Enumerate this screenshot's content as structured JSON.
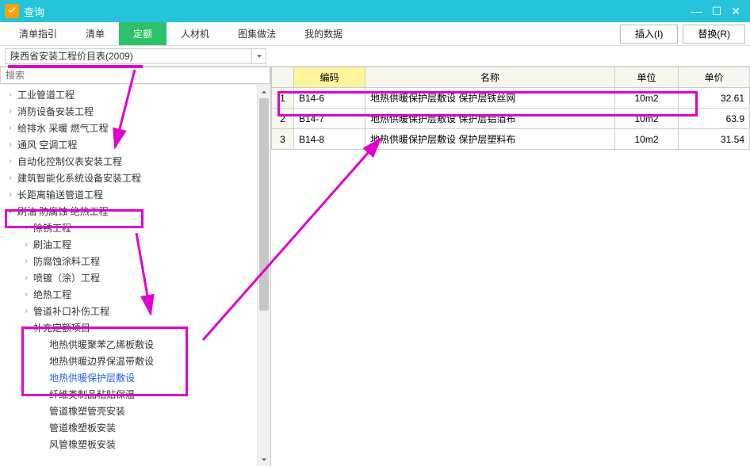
{
  "title": "查询",
  "main_tabs": [
    "清单指引",
    "清单",
    "定额",
    "人材机",
    "图集做法",
    "我的数据"
  ],
  "active_tab_index": 2,
  "top_buttons": {
    "insert": "插入(I)",
    "replace": "替换(R)"
  },
  "combo_text": "陕西省安装工程价目表(2009)",
  "search_placeholder": "搜索",
  "tree": [
    {
      "level": 1,
      "toggle": ">",
      "label": "工业管道工程"
    },
    {
      "level": 1,
      "toggle": ">",
      "label": "消防设备安装工程"
    },
    {
      "level": 1,
      "toggle": ">",
      "label": "给排水 采暖 燃气工程"
    },
    {
      "level": 1,
      "toggle": ">",
      "label": "通风 空调工程"
    },
    {
      "level": 1,
      "toggle": ">",
      "label": "自动化控制仪表安装工程"
    },
    {
      "level": 1,
      "toggle": ">",
      "label": "建筑智能化系统设备安装工程"
    },
    {
      "level": 1,
      "toggle": ">",
      "label": "长距离输送管道工程"
    },
    {
      "level": 1,
      "toggle": "v",
      "label": "刷油 防腐蚀 绝热工程"
    },
    {
      "level": 2,
      "toggle": ">",
      "label": "除锈工程"
    },
    {
      "level": 2,
      "toggle": ">",
      "label": "刷油工程"
    },
    {
      "level": 2,
      "toggle": ">",
      "label": "防腐蚀涂料工程"
    },
    {
      "level": 2,
      "toggle": ">",
      "label": "喷镀（涂）工程"
    },
    {
      "level": 2,
      "toggle": ">",
      "label": "绝热工程"
    },
    {
      "level": 2,
      "toggle": ">",
      "label": "管道补口补伤工程"
    },
    {
      "level": 2,
      "toggle": "v",
      "label": "补充定额项目"
    },
    {
      "level": 3,
      "toggle": "",
      "label": "地热供暖聚苯乙烯板敷设"
    },
    {
      "level": 3,
      "toggle": "",
      "label": "地热供暖边界保温带敷设"
    },
    {
      "level": 3,
      "toggle": "",
      "label": "地热供暖保护层敷设",
      "link": true
    },
    {
      "level": 3,
      "toggle": "",
      "label": "纤维类制品粘贴保温"
    },
    {
      "level": 3,
      "toggle": "",
      "label": "管道橡塑管壳安装"
    },
    {
      "level": 3,
      "toggle": "",
      "label": "管道橡塑板安装"
    },
    {
      "level": 3,
      "toggle": "",
      "label": "风管橡塑板安装"
    }
  ],
  "grid_headers": {
    "code": "编码",
    "name": "名称",
    "unit": "单位",
    "price": "单价"
  },
  "grid_rows": [
    {
      "n": "1",
      "code": "B14-6",
      "name": "地热供暖保护层敷设 保护层铁丝网",
      "unit": "10m2",
      "price": "32.61"
    },
    {
      "n": "2",
      "code": "B14-7",
      "name": "地热供暖保护层敷设 保护层铝箔布",
      "unit": "10m2",
      "price": "63.9"
    },
    {
      "n": "3",
      "code": "B14-8",
      "name": "地热供暖保护层敷设 保护层塑料布",
      "unit": "10m2",
      "price": "31.54"
    }
  ]
}
